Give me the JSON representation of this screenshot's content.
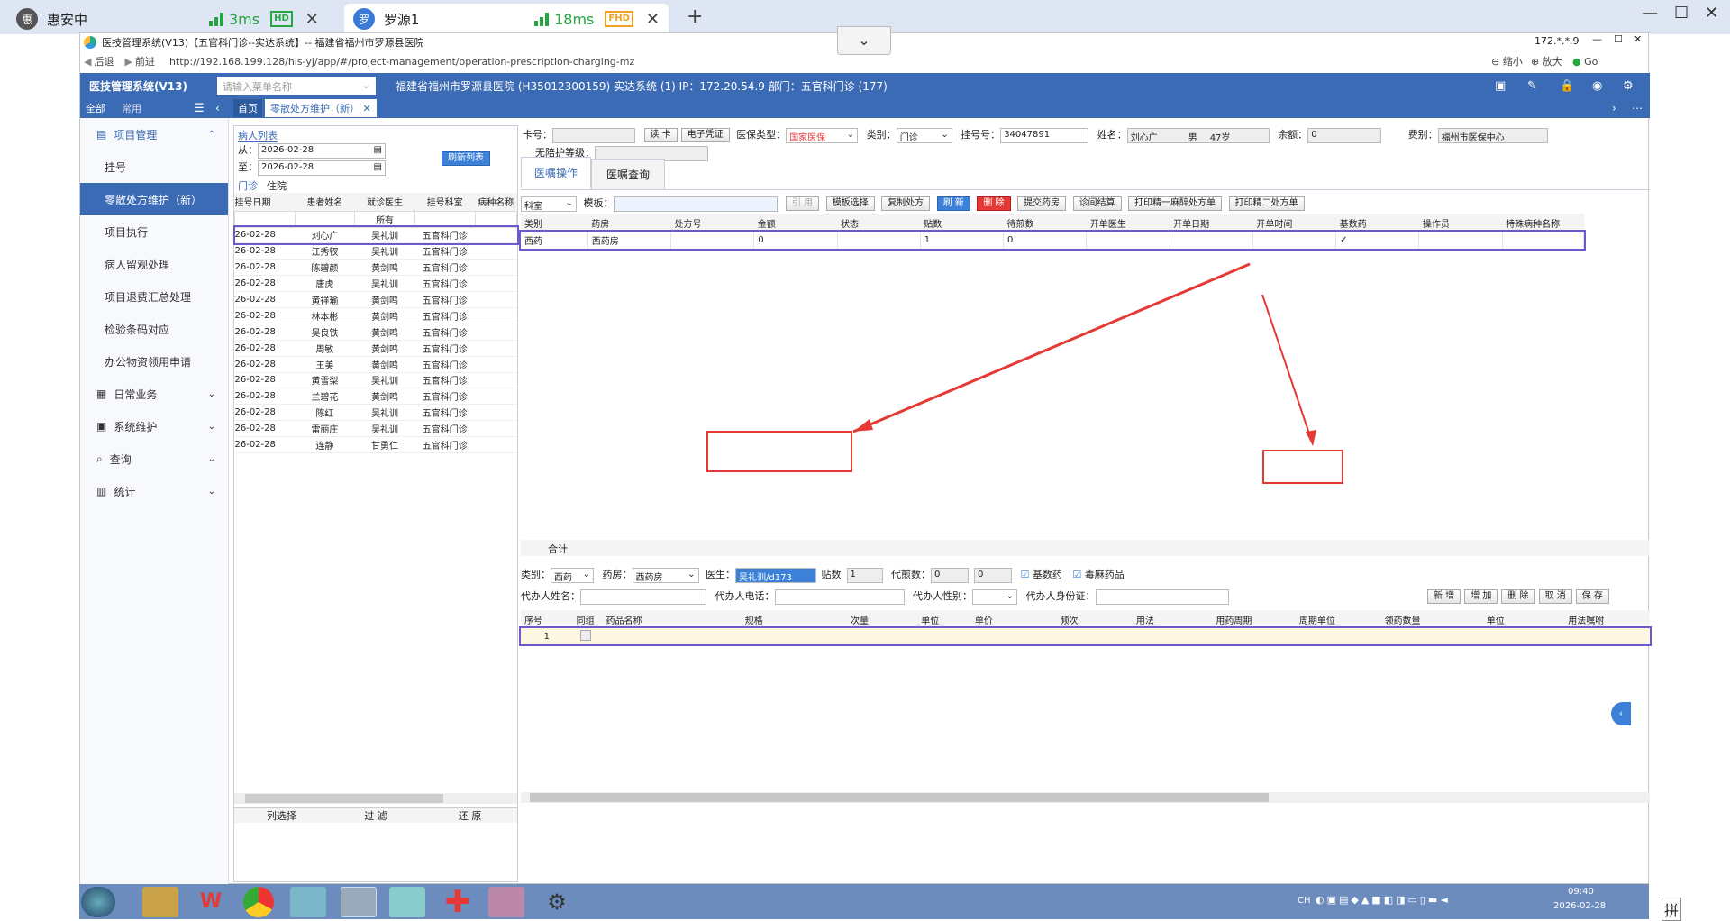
{
  "browser_tabs": [
    {
      "avatar": "惠",
      "title": "惠安中",
      "ping": "3ms",
      "badge": "HD"
    },
    {
      "avatar": "罗",
      "title": "罗源1",
      "ping": "18ms",
      "badge": "FHD"
    }
  ],
  "window": {
    "title": "医技管理系统(V13)【五官科门诊--实达系统】-- 福建省福州市罗源县医院",
    "back": "后退",
    "forward": "前进",
    "url": "http://192.168.199.128/his-yj/app/#/project-management/operation-prescription-charging-mz",
    "zoom_out": "缩小",
    "zoom_in": "放大",
    "go": "Go",
    "ip_short": "172.*.*.9"
  },
  "app": {
    "name": "医技管理系统(V13)",
    "menu_search_placeholder": "请输入菜单名称",
    "hospital_info": "福建省福州市罗源县医院 (H35012300159) 实达系统 (1) IP：172.20.54.9 部门：五官科门诊 (177)",
    "tab_all": "全部",
    "tab_common": "常用",
    "tab_home": "首页",
    "tab_current": "零散处方维护（新）"
  },
  "sidebar": {
    "groups": [
      {
        "label": "项目管理",
        "expanded": true,
        "items": [
          "挂号",
          "零散处方维护（新）",
          "项目执行",
          "病人留观处理",
          "项目退费汇总处理",
          "检验条码对应",
          "办公物资领用申请"
        ]
      },
      {
        "label": "日常业务"
      },
      {
        "label": "系统维护"
      },
      {
        "label": "查询"
      },
      {
        "label": "统计"
      }
    ],
    "active": "零散处方维护（新）"
  },
  "patient_list": {
    "title": "病人列表",
    "from_label": "从：",
    "from": "2026-02-28",
    "to_label": "至：",
    "to": "2026-02-28",
    "refresh": "刷新列表",
    "tabs": [
      "门诊",
      "住院"
    ],
    "columns": [
      "挂号日期",
      "患者姓名",
      "就诊医生",
      "挂号科室",
      "病种名称"
    ],
    "filter_doctor": "所有",
    "rows": [
      [
        "26-02-28",
        "刘心广",
        "吴礼训",
        "五官科门诊"
      ],
      [
        "26-02-28",
        "江秀钗",
        "吴礼训",
        "五官科门诊"
      ],
      [
        "26-02-28",
        "陈碧颜",
        "黄剑鸣",
        "五官科门诊"
      ],
      [
        "26-02-28",
        "唐虎",
        "吴礼训",
        "五官科门诊"
      ],
      [
        "26-02-28",
        "黄祥瑜",
        "黄剑鸣",
        "五官科门诊"
      ],
      [
        "26-02-28",
        "林本彬",
        "黄剑鸣",
        "五官科门诊"
      ],
      [
        "26-02-28",
        "吴良铁",
        "黄剑鸣",
        "五官科门诊"
      ],
      [
        "26-02-28",
        "周敏",
        "黄剑鸣",
        "五官科门诊"
      ],
      [
        "26-02-28",
        "王美",
        "黄剑鸣",
        "五官科门诊"
      ],
      [
        "26-02-28",
        "黄雪梨",
        "吴礼训",
        "五官科门诊"
      ],
      [
        "26-02-28",
        "兰碧花",
        "黄剑鸣",
        "五官科门诊"
      ],
      [
        "26-02-28",
        "陈红",
        "吴礼训",
        "五官科门诊"
      ],
      [
        "26-02-28",
        "雷丽庄",
        "吴礼训",
        "五官科门诊"
      ],
      [
        "26-02-28",
        "连静",
        "甘勇仁",
        "五官科门诊"
      ]
    ],
    "footer": [
      "列选择",
      "过 滤",
      "还 原"
    ]
  },
  "patient_info": {
    "card_label": "卡号：",
    "read_card": "读 卡",
    "e_voucher": "电子凭证",
    "insurance_type_label": "医保类型：",
    "insurance_type": "国家医保",
    "category_label": "类别：",
    "category": "门诊",
    "reg_no_label": "挂号号：",
    "reg_no": "34047891",
    "name_label": "姓名：",
    "name": "刘心广",
    "gender": "男",
    "age": "47岁",
    "balance_label": "余额：",
    "balance": "0",
    "fee_type_label": "费别：",
    "fee_type": "福州市医保中心",
    "care_level_label": "无陪护等级："
  },
  "tabs": [
    "医嘱操作",
    "医嘱查询"
  ],
  "toolbar": {
    "dept": "科室",
    "template_label": "模板：",
    "cite": "引 用",
    "template_select": "模板选择",
    "copy_rx": "复制处方",
    "refresh": "刷 新",
    "delete": "删 除",
    "submit_pharmacy": "提交药房",
    "clinic_settle": "诊间结算",
    "print_narcotic": "打印精一麻醉处方单",
    "print_psych2": "打印精二处方单"
  },
  "rx_table": {
    "columns": [
      "类别",
      "药房",
      "处方号",
      "金额",
      "状态",
      "贴数",
      "待煎数",
      "开单医生",
      "开单日期",
      "开单时间",
      "基数药",
      "操作员",
      "特殊病种名称"
    ],
    "rows": [
      [
        "西药",
        "西药房",
        "",
        "0",
        "",
        "1",
        "0",
        "",
        "",
        "",
        "✓",
        "",
        ""
      ]
    ],
    "total_label": "合计"
  },
  "detail_form": {
    "category_label": "类别：",
    "category": "西药",
    "pharmacy_label": "药房：",
    "pharmacy": "西药房",
    "doctor_label": "医生：",
    "doctor": "吴礼训/d173",
    "packets_label": "贴数",
    "packets": "1",
    "decoct_label": "代煎数：",
    "decoct": "0",
    "decoct2": "0",
    "base_drug": "基数药",
    "toxic_drug": "毒麻药品",
    "agent_name_label": "代办人姓名：",
    "agent_phone_label": "代办人电话：",
    "agent_gender_label": "代办人性别：",
    "agent_id_label": "代办人身份证：",
    "btn_new": "新 增",
    "btn_add": "增 加",
    "btn_del": "删 除",
    "btn_cancel": "取 消",
    "btn_save": "保 存"
  },
  "detail_table": {
    "columns": [
      "序号",
      "同组",
      "药品名称",
      "规格",
      "次量",
      "单位",
      "单价",
      "频次",
      "用法",
      "用药周期",
      "周期单位",
      "领药数量",
      "单位",
      "用法嘱咐"
    ],
    "rows": [
      [
        "1"
      ]
    ]
  },
  "taskbar": {
    "ime": "CH",
    "time": "09:40",
    "date": "2026-02-28",
    "ime2": "拼"
  },
  "colors": {
    "header_blue": "#3c6bb5",
    "annotation_red": "#e53935",
    "selection_purple": "#6a5acd",
    "insurance_red": "#e53935"
  }
}
